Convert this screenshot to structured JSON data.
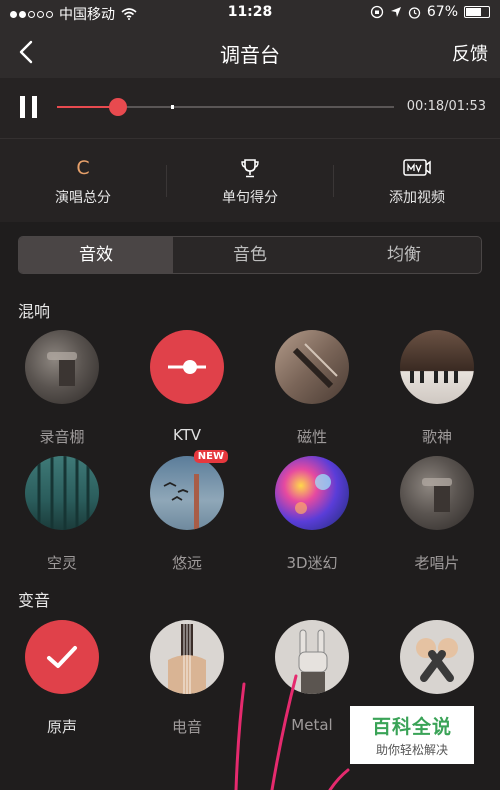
{
  "status_bar": {
    "carrier": "中国移动",
    "time": "11:28",
    "battery": "67%",
    "battery_level": 0.67
  },
  "nav": {
    "title": "调音台",
    "feedback_label": "反馈",
    "back_icon": "chevron-left-icon"
  },
  "player": {
    "time_label": "00:18/01:53",
    "progress": 0.18,
    "buffered": 0.34,
    "pause_icon": "pause-icon"
  },
  "scores": [
    {
      "label": "演唱总分",
      "value": "C"
    },
    {
      "label": "单句得分",
      "icon": "trophy-icon"
    },
    {
      "label": "添加视频",
      "icon": "mv-icon"
    }
  ],
  "tabs": [
    {
      "label": "音效",
      "active": true
    },
    {
      "label": "音色",
      "active": false
    },
    {
      "label": "均衡",
      "active": false
    }
  ],
  "reverb": {
    "title": "混响",
    "items": [
      {
        "name": "录音棚",
        "selected": false
      },
      {
        "name": "KTV",
        "selected": true
      },
      {
        "name": "磁性",
        "selected": false
      },
      {
        "name": "歌神",
        "selected": false
      },
      {
        "name": "空灵",
        "selected": false
      },
      {
        "name": "悠远",
        "selected": false,
        "badge": "NEW"
      },
      {
        "name": "3D迷幻",
        "selected": false
      },
      {
        "name": "老唱片",
        "selected": false
      }
    ]
  },
  "voice_change": {
    "title": "变音",
    "items": [
      {
        "name": "原声",
        "selected": true
      },
      {
        "name": "电音",
        "selected": false
      },
      {
        "name": "Metal",
        "selected": false
      },
      {
        "name": "",
        "selected": false
      }
    ]
  },
  "watermark": {
    "line1": "百科全说",
    "line2": "助你轻松解决"
  },
  "colors": {
    "accent": "#e84a4f",
    "background": "#1f1d1d",
    "grade": "#e6a06a"
  }
}
